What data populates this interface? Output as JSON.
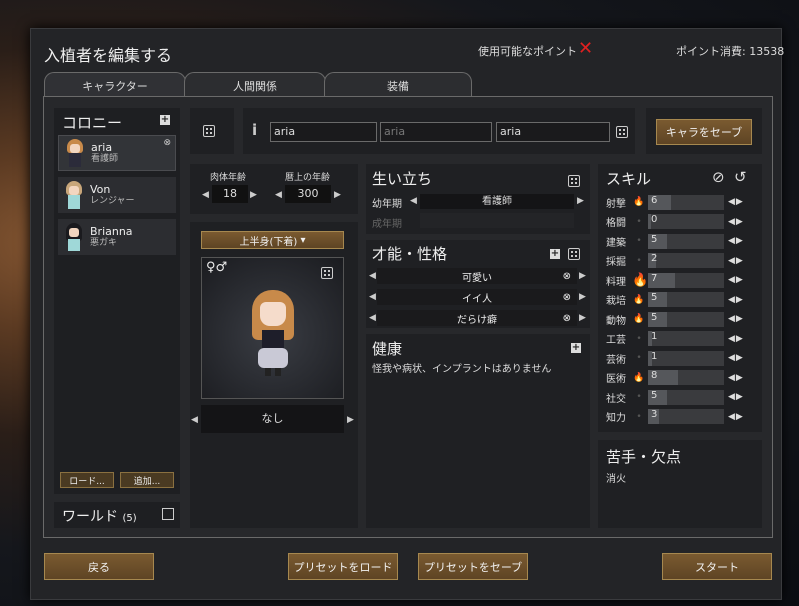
{
  "window": {
    "title": "入植者を編集する",
    "points_label": "使用可能なポイント",
    "points_icon": "red-x-icon",
    "points_cost": "ポイント消費: 13538"
  },
  "tabs": [
    "キャラクター",
    "人間関係",
    "装備"
  ],
  "colony": {
    "title": "コロニー",
    "pawns": [
      {
        "name": "aria",
        "role": "看護師"
      },
      {
        "name": "Von",
        "role": "レンジャー"
      },
      {
        "name": "Brianna",
        "role": "悪ガキ"
      }
    ],
    "load_label": "ロード...",
    "add_label": "追加...",
    "world_label": "ワールド",
    "world_count": "(5)"
  },
  "names": {
    "first": "aria",
    "nick": "aria",
    "last": "aria",
    "save_label": "キャラをセーブ"
  },
  "age": {
    "bio_label": "肉体年齢",
    "bio_value": "18",
    "chrono_label": "暦上の年齢",
    "chrono_value": "300"
  },
  "apparel": {
    "layer_label": "上半身(下着)",
    "bottom_label": "なし"
  },
  "backstory": {
    "title": "生い立ち",
    "childhood_label": "幼年期",
    "childhood_value": "看護師",
    "adulthood_label": "成年期"
  },
  "traits": {
    "title": "才能・性格",
    "items": [
      "可愛い",
      "イイ人",
      "だらけ癖"
    ]
  },
  "health": {
    "title": "健康",
    "text": "怪我や病状、インプラントはありません"
  },
  "skills": {
    "title": "スキル",
    "items": [
      {
        "name": "射撃",
        "value": "6",
        "passion": "minor",
        "level": 6
      },
      {
        "name": "格闘",
        "value": "0",
        "passion": "none",
        "level": 0
      },
      {
        "name": "建築",
        "value": "5",
        "passion": "none",
        "level": 5
      },
      {
        "name": "採掘",
        "value": "2",
        "passion": "none",
        "level": 2
      },
      {
        "name": "料理",
        "value": "7",
        "passion": "major",
        "level": 7
      },
      {
        "name": "栽培",
        "value": "5",
        "passion": "minor",
        "level": 5
      },
      {
        "name": "動物",
        "value": "5",
        "passion": "minor",
        "level": 5
      },
      {
        "name": "工芸",
        "value": "1",
        "passion": "none",
        "level": 1
      },
      {
        "name": "芸術",
        "value": "1",
        "passion": "none",
        "level": 1
      },
      {
        "name": "医術",
        "value": "8",
        "passion": "minor",
        "level": 8
      },
      {
        "name": "社交",
        "value": "5",
        "passion": "none",
        "level": 5
      },
      {
        "name": "知力",
        "value": "3",
        "passion": "none",
        "level": 3
      }
    ]
  },
  "incapable": {
    "title": "苦手・欠点",
    "text": "消火"
  },
  "bottom": {
    "back_label": "戻る",
    "load_preset_label": "プリセットをロード",
    "save_preset_label": "プリセットをセーブ",
    "start_label": "スタート"
  },
  "colors": {
    "accent_gold": "#a6884f",
    "passion": "#e8951f",
    "alert": "#e02020"
  }
}
